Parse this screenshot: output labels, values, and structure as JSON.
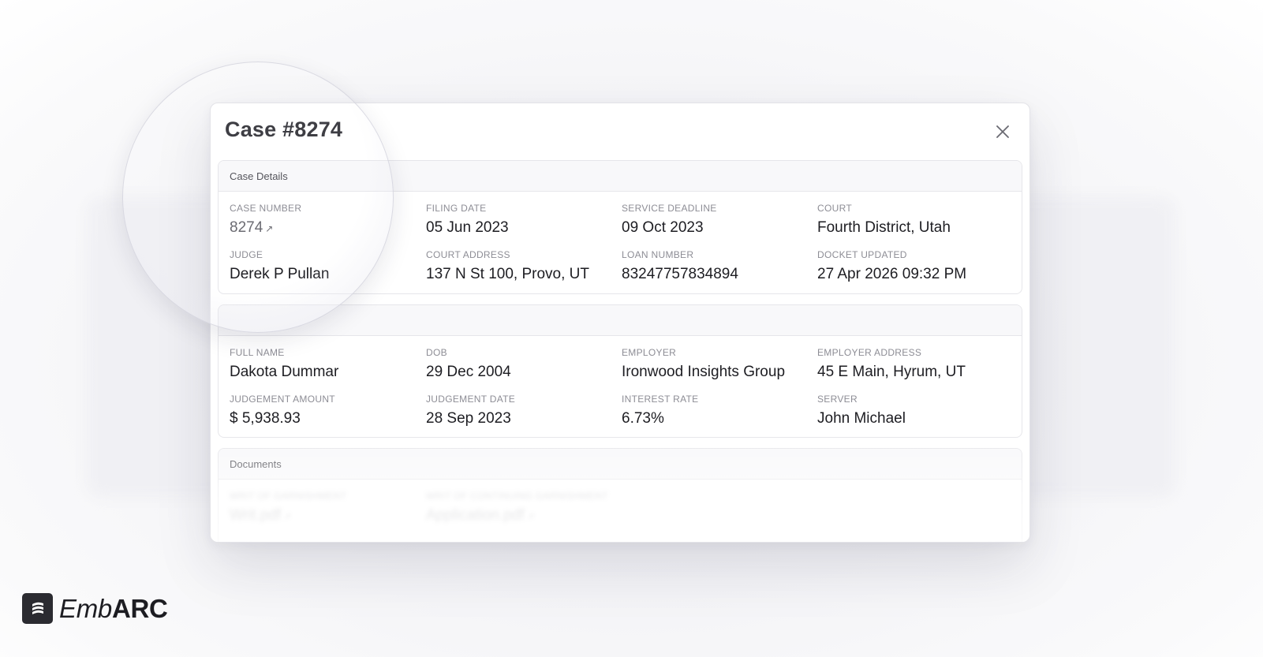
{
  "modal": {
    "title": "Case #8274"
  },
  "sections": {
    "case_details": {
      "header": "Case Details",
      "fields": [
        {
          "label": "CASE NUMBER",
          "value": "8274",
          "link": true
        },
        {
          "label": "FILING DATE",
          "value": "05 Jun 2023"
        },
        {
          "label": "SERVICE DEADLINE",
          "value": "09 Oct 2023"
        },
        {
          "label": "COURT",
          "value": "Fourth District, Utah"
        },
        {
          "label": "JUDGE",
          "value": "Derek P Pullan"
        },
        {
          "label": "COURT ADDRESS",
          "value": "137 N St 100, Provo, UT"
        },
        {
          "label": "LOAN NUMBER",
          "value": "83247757834894"
        },
        {
          "label": "DOCKET UPDATED",
          "value": "27 Apr 2026 09:32 PM"
        }
      ]
    },
    "debtor": {
      "header": "",
      "fields": [
        {
          "label": "FULL NAME",
          "value": "Dakota Dummar"
        },
        {
          "label": "DOB",
          "value": "29 Dec 2004"
        },
        {
          "label": "EMPLOYER",
          "value": "Ironwood Insights Group"
        },
        {
          "label": "EMPLOYER ADDRESS",
          "value": "45 E Main, Hyrum, UT"
        },
        {
          "label": "JUDGEMENT AMOUNT",
          "value": "$ 5,938.93"
        },
        {
          "label": "JUDGEMENT DATE",
          "value": "28 Sep 2023"
        },
        {
          "label": "INTEREST RATE",
          "value": "6.73%"
        },
        {
          "label": "SERVER",
          "value": "John Michael"
        }
      ]
    },
    "documents": {
      "header": "Documents",
      "fields": [
        {
          "label": "WRIT OF GARNISHMENT",
          "value": "Writ.pdf",
          "link": true
        },
        {
          "label": "WRIT OF CONTINUING GARNISHMENT",
          "value": "Application.pdf",
          "link": true
        }
      ]
    }
  },
  "logo": {
    "light": "Emb",
    "bold": "ARC"
  },
  "icons": {
    "close": "close-icon",
    "external_link": "arrow-up-right-icon"
  },
  "colors": {
    "text": "#1d1d22",
    "label": "#8d8d95",
    "link": "#6b6b72",
    "logo_mark": "#2b2b31"
  }
}
